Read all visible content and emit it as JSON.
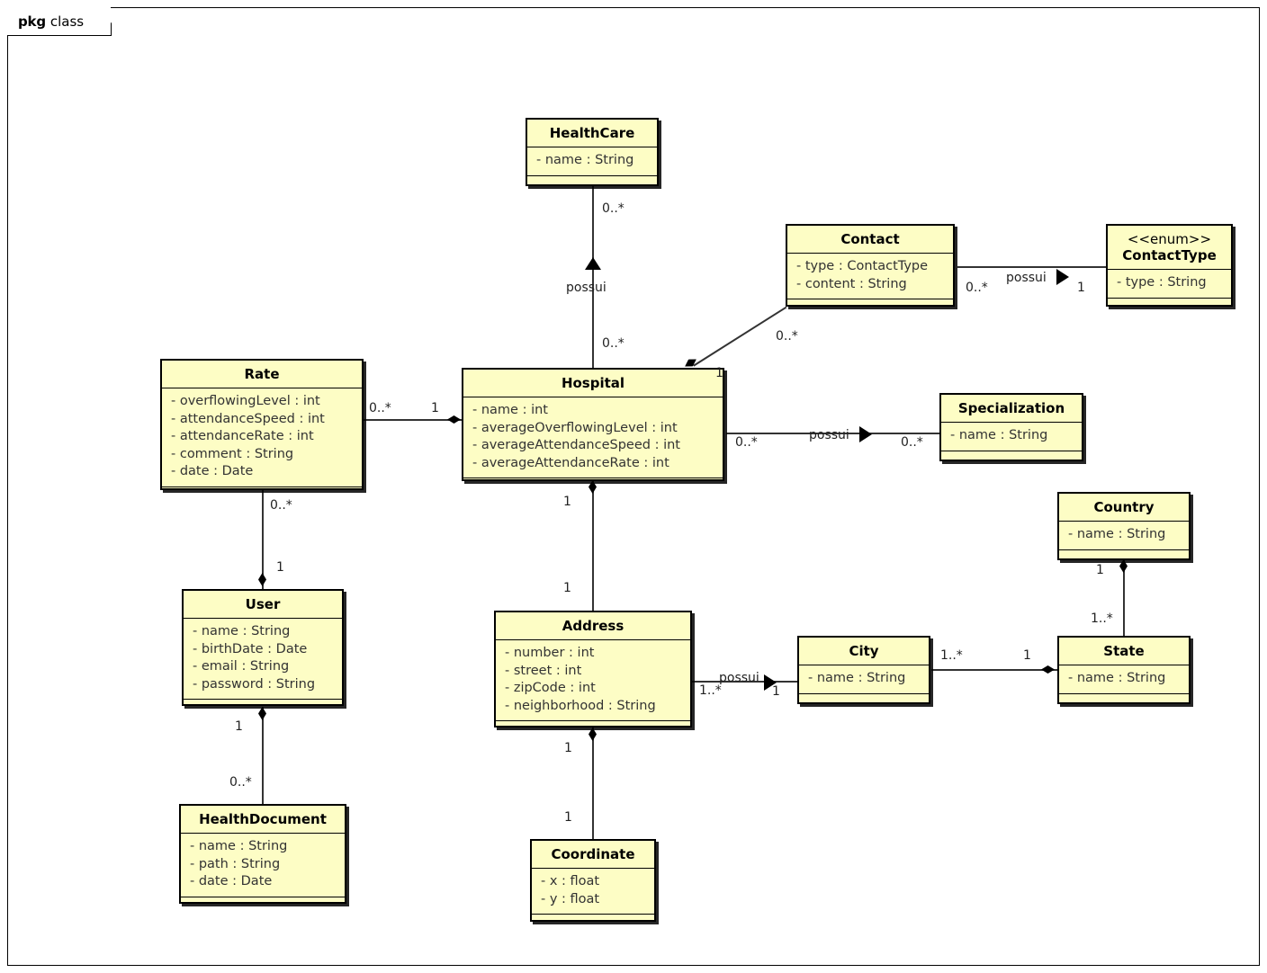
{
  "package": {
    "keyword": "pkg",
    "name": "class"
  },
  "classes": [
    {
      "id": "healthcare",
      "name": "HealthCare",
      "stereotype": "",
      "attributes": [
        "- name : String"
      ]
    },
    {
      "id": "contact",
      "name": "Contact",
      "stereotype": "",
      "attributes": [
        "- type : ContactType",
        "- content : String"
      ]
    },
    {
      "id": "contacttype",
      "name": "ContactType",
      "stereotype": "<<enum>>",
      "attributes": [
        "- type : String"
      ]
    },
    {
      "id": "rate",
      "name": "Rate",
      "stereotype": "",
      "attributes": [
        "- overflowingLevel : int",
        "- attendanceSpeed : int",
        "- attendanceRate : int",
        "- comment : String",
        "- date : Date"
      ]
    },
    {
      "id": "hospital",
      "name": "Hospital",
      "stereotype": "",
      "attributes": [
        "- name : int",
        "- averageOverflowingLevel : int",
        "- averageAttendanceSpeed : int",
        "- averageAttendanceRate : int"
      ]
    },
    {
      "id": "specialization",
      "name": "Specialization",
      "stereotype": "",
      "attributes": [
        "- name : String"
      ]
    },
    {
      "id": "country",
      "name": "Country",
      "stereotype": "",
      "attributes": [
        "- name : String"
      ]
    },
    {
      "id": "user",
      "name": "User",
      "stereotype": "",
      "attributes": [
        "- name : String",
        "- birthDate : Date",
        "- email : String",
        "- password : String"
      ]
    },
    {
      "id": "address",
      "name": "Address",
      "stereotype": "",
      "attributes": [
        "- number : int",
        "- street : int",
        "- zipCode : int",
        "- neighborhood : String"
      ]
    },
    {
      "id": "city",
      "name": "City",
      "stereotype": "",
      "attributes": [
        "- name : String"
      ]
    },
    {
      "id": "state",
      "name": "State",
      "stereotype": "",
      "attributes": [
        "- name : String"
      ]
    },
    {
      "id": "healthdocument",
      "name": "HealthDocument",
      "stereotype": "",
      "attributes": [
        "- name : String",
        "- path : String",
        "- date : Date"
      ]
    },
    {
      "id": "coordinate",
      "name": "Coordinate",
      "stereotype": "",
      "attributes": [
        "- x : float",
        "- y : float"
      ]
    }
  ],
  "relations": {
    "healthcare_hospital": {
      "label": "possui",
      "source_mult": "0..*",
      "target_mult": "0..*"
    },
    "contact_contacttype": {
      "label": "possui",
      "source_mult": "0..*",
      "target_mult": "1"
    },
    "contact_hospital": {
      "label": "",
      "source_mult": "0..*",
      "target_mult": "1"
    },
    "rate_hospital": {
      "label": "",
      "source_mult": "0..*",
      "target_mult": "1"
    },
    "rate_user": {
      "label": "",
      "source_mult": "0..*",
      "target_mult": "1"
    },
    "hospital_specialization": {
      "label": "possui",
      "source_mult": "0..*",
      "target_mult": "0..*"
    },
    "hospital_address": {
      "label": "",
      "source_mult": "1",
      "target_mult": "1"
    },
    "user_healthdocument": {
      "label": "",
      "source_mult": "1",
      "target_mult": "0..*"
    },
    "address_city": {
      "label": "possui",
      "source_mult": "1..*",
      "target_mult": "1"
    },
    "address_coordinate": {
      "label": "",
      "source_mult": "1",
      "target_mult": "1"
    },
    "city_state": {
      "label": "",
      "source_mult": "1..*",
      "target_mult": "1"
    },
    "country_state": {
      "label": "",
      "source_mult": "1",
      "target_mult": "1..*"
    }
  },
  "colors": {
    "class_fill": "#fdfdc5",
    "class_border": "#000000",
    "line": "#333333",
    "background": "#ffffff"
  }
}
